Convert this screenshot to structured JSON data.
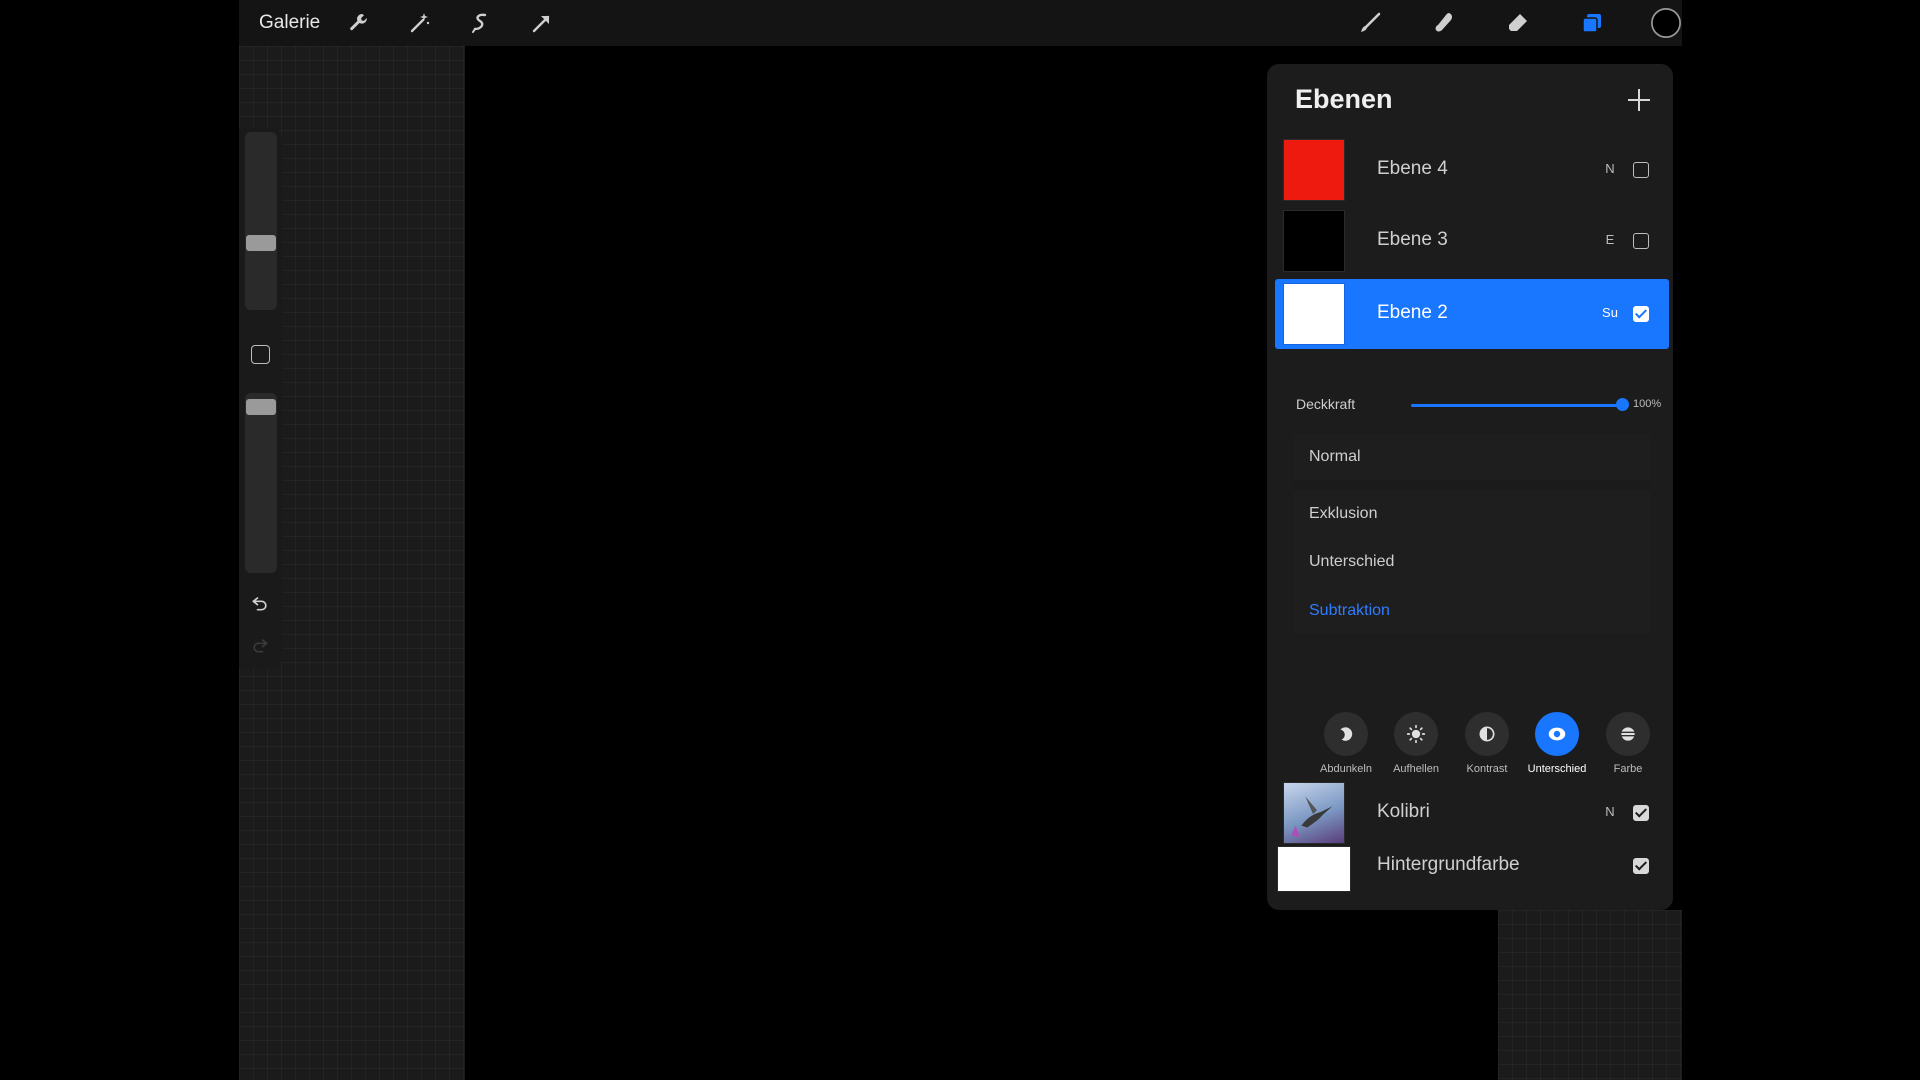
{
  "toolbar": {
    "gallery_label": "Galerie",
    "left_tools": [
      "wrench-icon",
      "magic-wand-icon",
      "selection-icon",
      "transform-arrow-icon"
    ],
    "right_tools": [
      "brush-icon",
      "smudge-icon",
      "eraser-icon",
      "layers-icon",
      "color-picker-icon"
    ],
    "accent_color": "#1976ff",
    "current_color": "#000000"
  },
  "sidebar": {
    "brush_size_level": 0.5,
    "opacity_level": 0.95
  },
  "layers": {
    "title": "Ebenen",
    "add_icon": "plus-icon",
    "items": [
      {
        "name": "Ebene 4",
        "mode": "N",
        "visible": false,
        "thumb_color": "#ef1a0f",
        "selected": false
      },
      {
        "name": "Ebene 3",
        "mode": "E",
        "visible": false,
        "thumb_color": "#000000",
        "selected": false
      },
      {
        "name": "Ebene 2",
        "mode": "Su",
        "visible": true,
        "thumb_color": "#ffffff",
        "selected": true
      },
      {
        "name": "Kolibri",
        "mode": "N",
        "visible": true,
        "thumb_color": "#6f8fb8",
        "selected": false
      },
      {
        "name": "Hintergrundfarbe",
        "mode": "",
        "visible": true,
        "thumb_color": "#ffffff",
        "selected": false
      }
    ]
  },
  "opacity": {
    "label": "Deckkraft",
    "value_text": "100%",
    "value": 1.0
  },
  "blend_modes": {
    "normal": "Normal",
    "items": [
      "Exklusion",
      "Unterschied",
      "Subtraktion"
    ],
    "active": "Subtraktion"
  },
  "categories": [
    {
      "label": "Abdunkeln",
      "icon": "moon-icon",
      "active": false
    },
    {
      "label": "Aufhellen",
      "icon": "sun-icon",
      "active": false
    },
    {
      "label": "Kontrast",
      "icon": "contrast-icon",
      "active": false
    },
    {
      "label": "Unterschied",
      "icon": "difference-icon",
      "active": true
    },
    {
      "label": "Farbe",
      "icon": "color-icon",
      "active": false
    }
  ]
}
